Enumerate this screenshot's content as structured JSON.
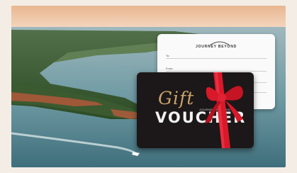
{
  "voucher_card": {
    "brand": "JOURNEY BEYOND",
    "small_brand": "JOURNEY BEYOND",
    "gift_text": "Gift",
    "voucher_text": "VOUCHER",
    "form_labels": [
      "To:",
      "From:"
    ]
  },
  "colors": {
    "card_black": "#1c1718",
    "card_gold": "#c8a36a",
    "ribbon_red": "#d7192a",
    "background": "#f3ede6"
  }
}
